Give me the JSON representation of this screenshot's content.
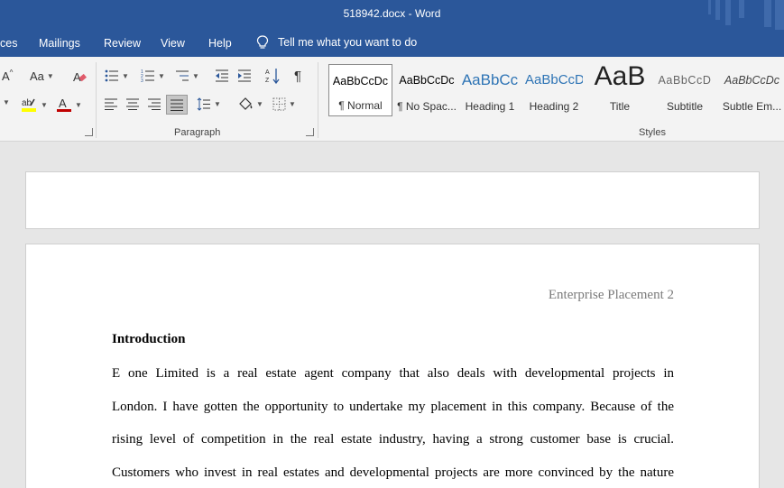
{
  "window": {
    "title": "518942.docx  -  Word"
  },
  "menu": {
    "tabs": [
      "ces",
      "Mailings",
      "Review",
      "View",
      "Help"
    ],
    "tell_me": "Tell me what you want to do"
  },
  "ribbon": {
    "font_group": {
      "change_case": "Aa",
      "grow": "A"
    },
    "paragraph_label": "Paragraph",
    "styles_label": "Styles",
    "styles": [
      {
        "sample": "AaBbCcDc",
        "name": "¶ Normal"
      },
      {
        "sample": "AaBbCcDc",
        "name": "¶ No Spac..."
      },
      {
        "sample": "AaBbCc",
        "name": "Heading 1"
      },
      {
        "sample": "AaBbCcD",
        "name": "Heading 2"
      },
      {
        "sample": "AaB",
        "name": "Title"
      },
      {
        "sample": "AaBbCcD",
        "name": "Subtitle"
      },
      {
        "sample": "AaBbCcDc",
        "name": "Subtle Em..."
      }
    ]
  },
  "document": {
    "running_header": "Enterprise Placement 2",
    "heading": "Introduction",
    "lines": [
      "E one Limited is a real estate agent company that also deals with developmental projects in",
      "London. I have gotten the opportunity to undertake my placement in this company. Because of the",
      "rising level of competition in the real estate industry, having a strong customer base is crucial.",
      "Customers who invest in real estates and developmental projects are more convinced by the nature"
    ]
  },
  "colors": {
    "accent": "#2b579a",
    "ribbon_bg": "#f3f3f3",
    "canvas_bg": "#e6e6e6"
  }
}
